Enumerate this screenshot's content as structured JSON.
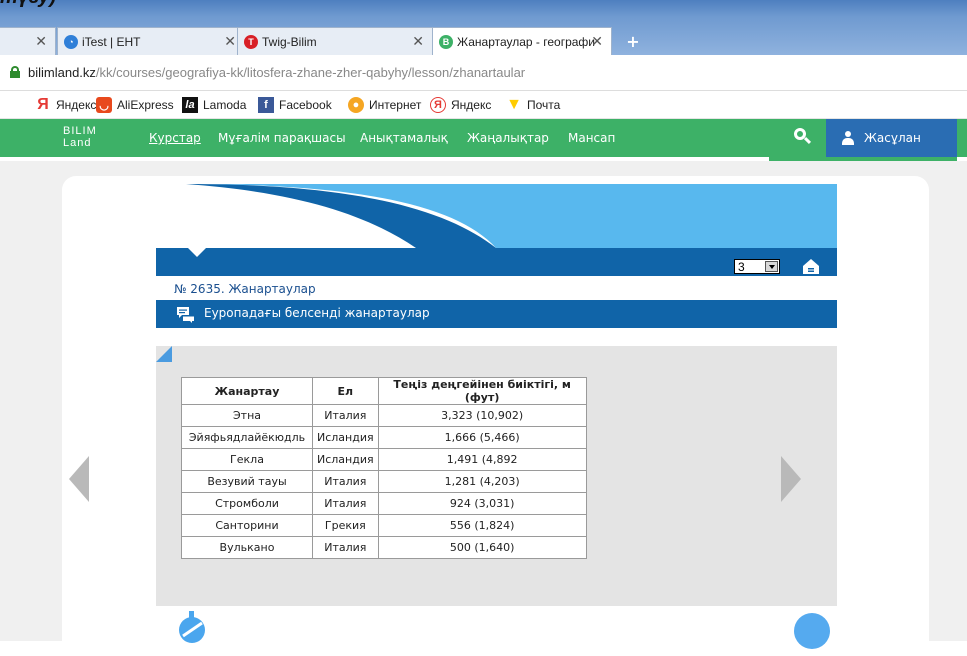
{
  "page_caption": "түзу)",
  "browser": {
    "tabs": [
      {
        "label": "",
        "icon": "partial-tab-icon"
      },
      {
        "label": "iTest | ЕНТ",
        "icon": "itest-icon"
      },
      {
        "label": "Twig-Bilim",
        "icon": "twig-icon"
      },
      {
        "label": "Жанартаулар - географи",
        "icon": "bilimland-icon"
      }
    ],
    "url_host": "bilimland.kz",
    "url_path": "/kk/courses/geografiya-kk/litosfera-zhane-zher-qabyhy/lesson/zhanartaular",
    "bookmarks": [
      {
        "label": "Яндекс",
        "icon": "yandex-icon",
        "color": "#e53a35"
      },
      {
        "label": "AliExpress",
        "icon": "aliexpress-icon",
        "color": "#e8491d"
      },
      {
        "label": "Lamoda",
        "icon": "lamoda-icon",
        "color": "#111111"
      },
      {
        "label": "Facebook",
        "icon": "facebook-icon",
        "color": "#3b5998"
      },
      {
        "label": "Интернет",
        "icon": "internet-icon",
        "color": "#f5a623"
      },
      {
        "label": "Яндекс",
        "icon": "yandex-browser-icon",
        "color": "#e53a35"
      },
      {
        "label": "Почта",
        "icon": "mail-icon",
        "color": "#ffcc00"
      }
    ]
  },
  "site": {
    "logo_top": "BILIM",
    "logo_bottom": "Land",
    "nav": [
      "Курстар",
      "Мұғалім парақшасы",
      "Анықтамалық",
      "Жаңалықтар",
      "Мансап"
    ],
    "user_label": "Жасұлан",
    "accent_color": "#3db167",
    "primary_blue": "#1064a8"
  },
  "lesson": {
    "page_select_value": "3",
    "title": "№ 2635. Жанартаулар",
    "section_title": "Еуропадағы белсенді жанартаулар"
  },
  "table": {
    "headers": [
      "Жанартау",
      "Ел",
      "Теңіз деңгейінен биіктігі, м (фут)"
    ],
    "rows": [
      [
        "Этна",
        "Италия",
        "3,323 (10,902)"
      ],
      [
        "Эйяфьядлайёкюдль",
        "Исландия",
        "1,666 (5,466)"
      ],
      [
        "Гекла",
        "Исландия",
        "1,491 (4,892"
      ],
      [
        "Везувий тауы",
        "Италия",
        "1,281 (4,203)"
      ],
      [
        "Стромболи",
        "Италия",
        "924 (3,031)"
      ],
      [
        "Санторини",
        "Грекия",
        "556 (1,824)"
      ],
      [
        "Вулькано",
        "Италия",
        "500 (1,640)"
      ]
    ]
  }
}
